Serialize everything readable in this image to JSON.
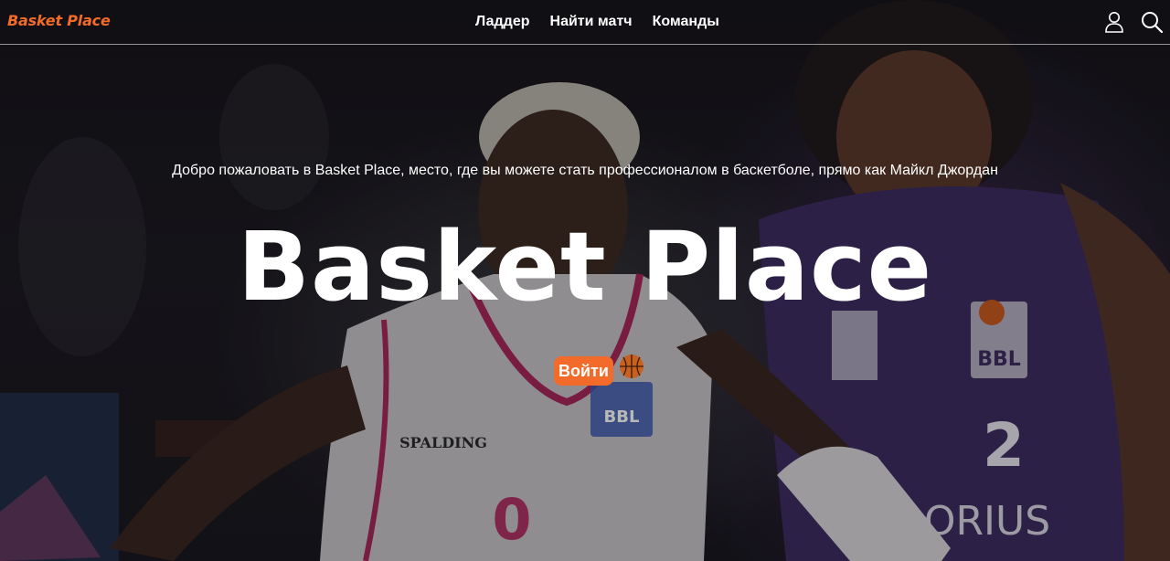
{
  "header": {
    "logo": "Basket Place",
    "nav": [
      "Ладдер",
      "Найти матч",
      "Команды"
    ],
    "icons": [
      "user-icon",
      "search-icon"
    ]
  },
  "hero": {
    "tagline": "Добро пожаловать в Basket Place, место, где вы можете стать профессионалом в баскетболе, прямо как Майкл Джордан",
    "title": "Basket Place",
    "login_label": "Войти",
    "background": "basketball-players-photo"
  },
  "colors": {
    "accent": "#f26b2a",
    "text": "#ffffff",
    "background": "#1a1820"
  }
}
